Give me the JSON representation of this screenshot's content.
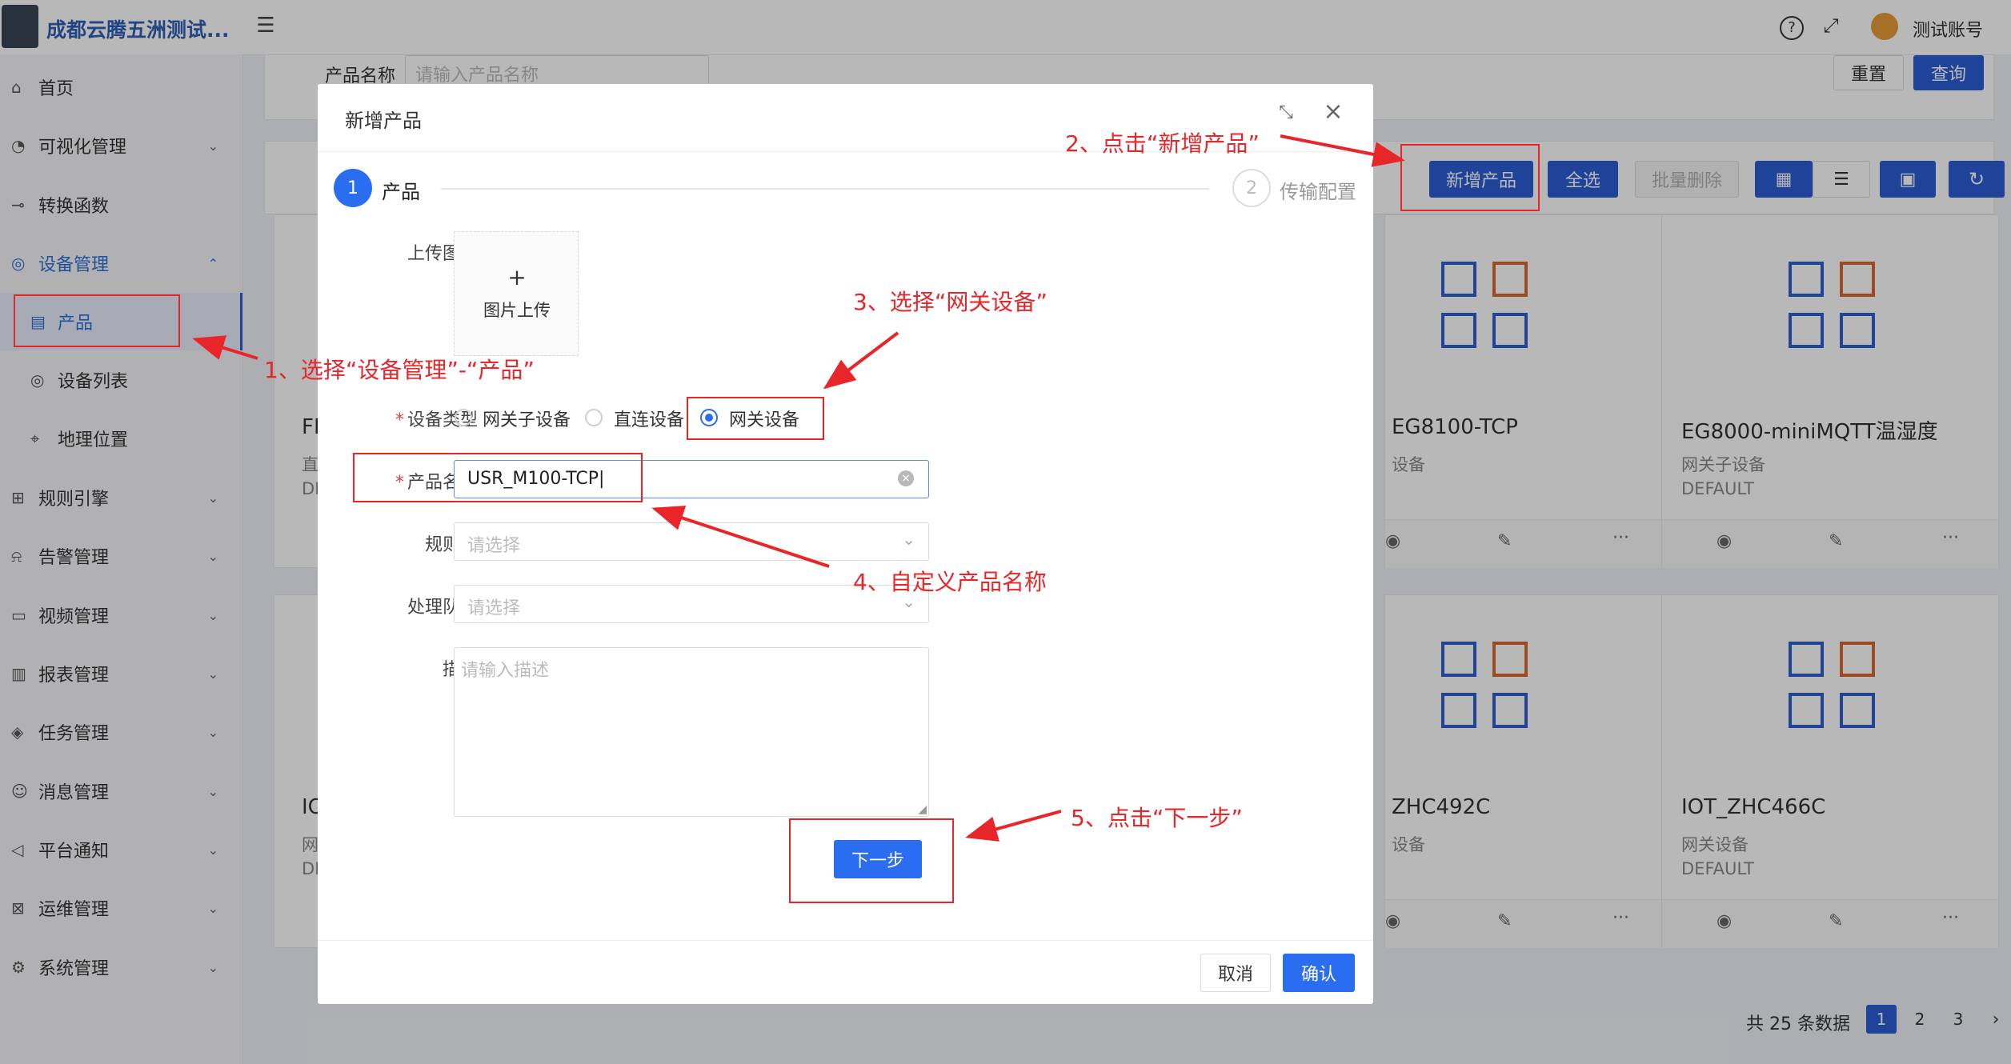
{
  "app": {
    "title": "成都云腾五洲测试...",
    "user": "测试账号"
  },
  "sidebar": {
    "items": [
      {
        "label": "首页",
        "icon": "home-icon"
      },
      {
        "label": "可视化管理",
        "icon": "dashboard-icon"
      },
      {
        "label": "转换函数",
        "icon": "function-icon"
      },
      {
        "label": "设备管理",
        "icon": "device-icon"
      },
      {
        "label": "产品",
        "icon": "file-icon"
      },
      {
        "label": "设备列表",
        "icon": "list-icon"
      },
      {
        "label": "地理位置",
        "icon": "location-icon"
      },
      {
        "label": "规则引擎",
        "icon": "rule-icon"
      },
      {
        "label": "告警管理",
        "icon": "alarm-icon"
      },
      {
        "label": "视频管理",
        "icon": "video-icon"
      },
      {
        "label": "报表管理",
        "icon": "report-icon"
      },
      {
        "label": "任务管理",
        "icon": "task-icon"
      },
      {
        "label": "消息管理",
        "icon": "message-icon"
      },
      {
        "label": "平台通知",
        "icon": "notify-icon"
      },
      {
        "label": "运维管理",
        "icon": "ops-icon"
      },
      {
        "label": "系统管理",
        "icon": "settings-icon"
      }
    ]
  },
  "search": {
    "label": "产品名称",
    "placeholder": "请输入产品名称",
    "reset": "重置",
    "query": "查询"
  },
  "toolbar": {
    "add": "新增产品",
    "select_all": "全选",
    "batch_delete": "批量删除"
  },
  "cards": [
    {
      "name": "FBI",
      "type": "直连",
      "tag": "DEF"
    },
    {
      "name": "EG8100-TCP",
      "type": "设备",
      "tag": ""
    },
    {
      "name": "EG8000-miniMQTT温湿度",
      "type": "网关子设备",
      "tag": "DEFAULT"
    },
    {
      "name": "IOT",
      "type": "网关",
      "tag": "DEF"
    },
    {
      "name": "ZHC492C",
      "type": "设备",
      "tag": ""
    },
    {
      "name": "IOT_ZHC466C",
      "type": "网关设备",
      "tag": "DEFAULT"
    }
  ],
  "pagination": {
    "total": "共 25 条数据",
    "pages": [
      "1",
      "2",
      "3"
    ]
  },
  "modal": {
    "title": "新增产品",
    "steps": [
      {
        "num": "1",
        "label": "产品"
      },
      {
        "num": "2",
        "label": "传输配置"
      }
    ],
    "upload_label": "上传图片",
    "upload_plus": "+",
    "upload_text": "图片上传",
    "device_type_label": "设备类型",
    "device_types": [
      "网关子设备",
      "直连设备",
      "网关设备"
    ],
    "selected_type": "网关设备",
    "product_name_label": "产品名称",
    "product_name_value": "USR_M100-TCP",
    "rule_chain_label": "规则链",
    "rule_chain_placeholder": "请选择",
    "queue_label": "处理队列",
    "queue_placeholder": "请选择",
    "desc_label": "描述",
    "desc_placeholder": "请输入描述",
    "next": "下一步",
    "cancel": "取消",
    "confirm": "确认"
  },
  "annotations": {
    "a1": "1、选择“设备管理”-“产品”",
    "a2": "2、点击“新增产品”",
    "a3": "3、选择“网关设备”",
    "a4": "4、自定义产品名称",
    "a5": "5、点击“下一步”"
  },
  "colors": {
    "primary": "#2b5ed3",
    "annotation": "#e8262a",
    "icon_blue": "#2f5fd0",
    "icon_orange": "#d9692d"
  }
}
